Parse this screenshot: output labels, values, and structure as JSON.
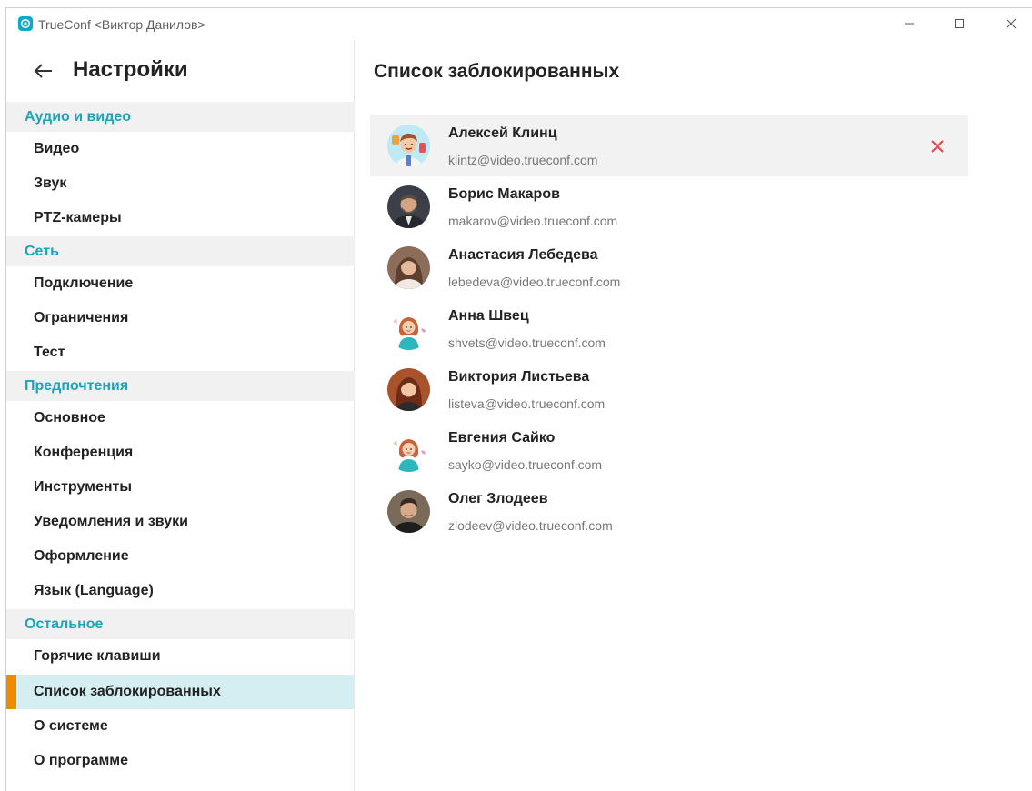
{
  "window": {
    "title": "TrueConf <Виктор Данилов>"
  },
  "sidebar": {
    "title": "Настройки",
    "sections": [
      {
        "label": "Аудио и видео"
      },
      {
        "label": "Сеть"
      },
      {
        "label": "Предпочтения"
      },
      {
        "label": "Остальное"
      }
    ],
    "items": [
      {
        "label": "Видео"
      },
      {
        "label": "Звук"
      },
      {
        "label": "PTZ-камеры"
      },
      {
        "label": "Подключение"
      },
      {
        "label": "Ограничения"
      },
      {
        "label": "Тест"
      },
      {
        "label": "Основное"
      },
      {
        "label": "Конференция"
      },
      {
        "label": "Инструменты"
      },
      {
        "label": "Уведомления и звуки"
      },
      {
        "label": "Оформление"
      },
      {
        "label": "Язык (Language)"
      },
      {
        "label": "Горячие клавиши"
      },
      {
        "label": "Список заблокированных",
        "active": true
      },
      {
        "label": "О системе"
      },
      {
        "label": "О программе"
      }
    ]
  },
  "main": {
    "title": "Список заблокированных",
    "contacts": [
      {
        "name": "Алексей Клинц",
        "email": "klintz@video.trueconf.com",
        "avatar": "cartoon-male-avatar"
      },
      {
        "name": "Борис Макаров",
        "email": "makarov@video.trueconf.com",
        "avatar": "photo-avatar"
      },
      {
        "name": "Анастасия Лебедева",
        "email": "lebedeva@video.trueconf.com",
        "avatar": "photo-avatar"
      },
      {
        "name": "Анна Швец",
        "email": "shvets@video.trueconf.com",
        "avatar": "cartoon-female-avatar"
      },
      {
        "name": "Виктория Листьева",
        "email": "listeva@video.trueconf.com",
        "avatar": "photo-avatar"
      },
      {
        "name": "Евгения Сайко",
        "email": "sayko@video.trueconf.com",
        "avatar": "cartoon-female-avatar"
      },
      {
        "name": "Олег Злодеев",
        "email": "zlodeev@video.trueconf.com",
        "avatar": "photo-avatar"
      }
    ]
  },
  "colors": {
    "accent": "#1ea3b9",
    "active_marker": "#f08a00",
    "active_bg": "#d4eef1",
    "unblock": "#e9454b"
  }
}
